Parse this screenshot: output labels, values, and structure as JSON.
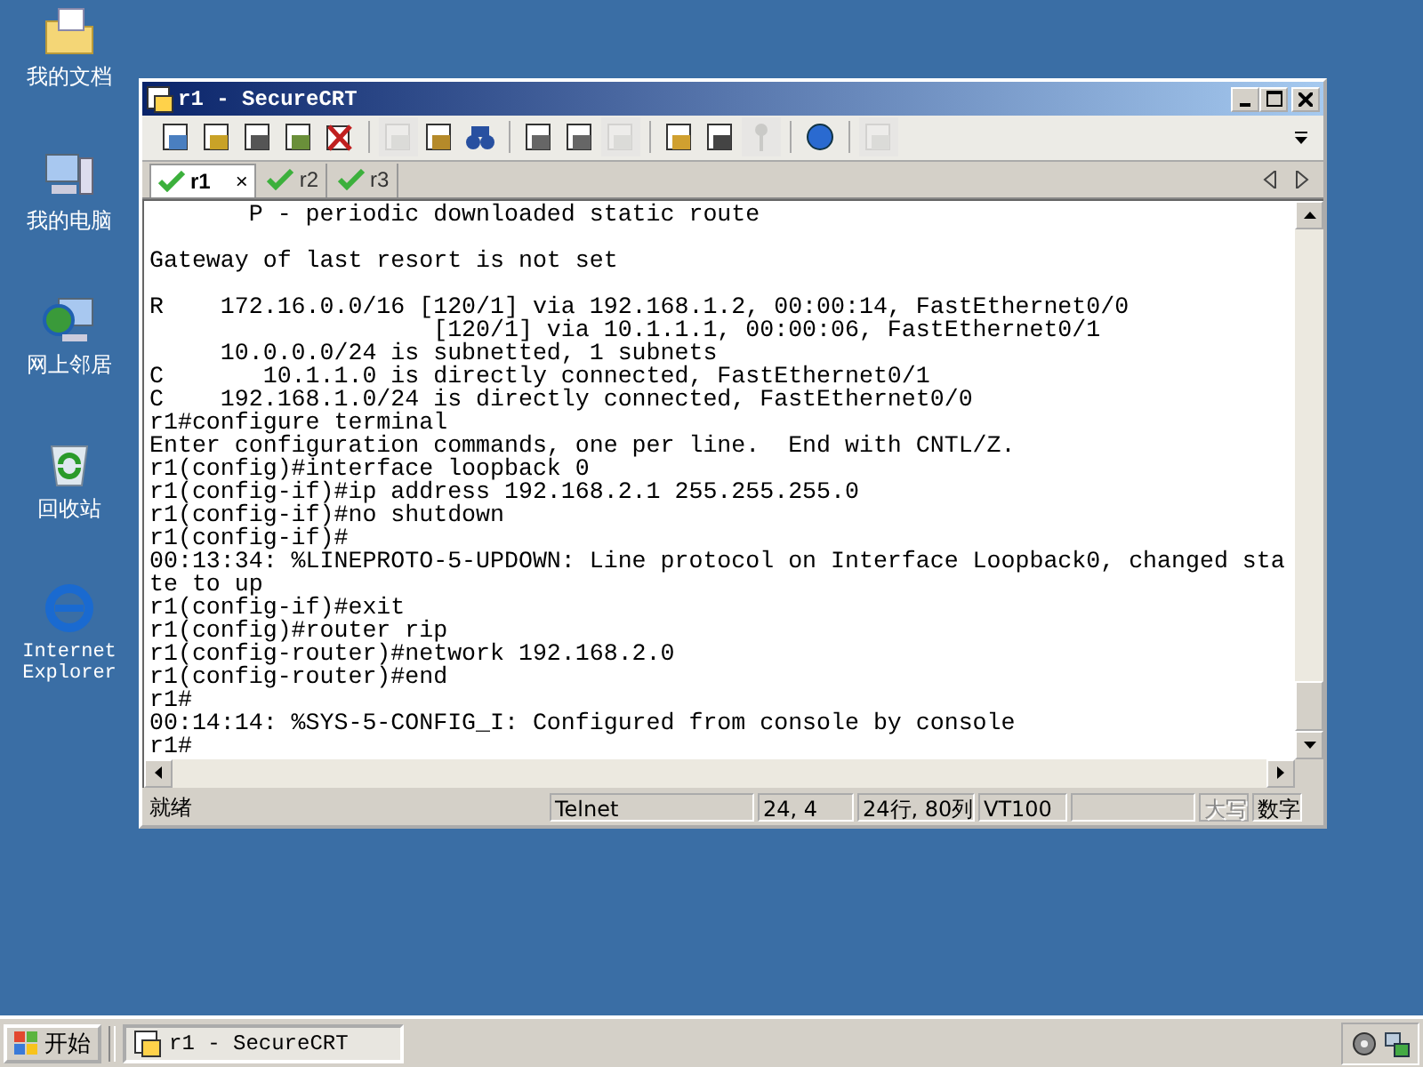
{
  "desktop_icons": [
    {
      "kind": "folder",
      "label": "我的文档"
    },
    {
      "kind": "computer",
      "label": "我的电脑"
    },
    {
      "kind": "network",
      "label": "网上邻居"
    },
    {
      "kind": "recycle",
      "label": "回收站"
    },
    {
      "kind": "browser",
      "label": "Internet Explorer"
    }
  ],
  "window": {
    "title": "r1 - SecureCRT",
    "toolbar": [
      {
        "buttons": [
          {
            "kind": "connect",
            "disabled": false
          },
          {
            "kind": "quick",
            "disabled": false
          },
          {
            "kind": "tab",
            "disabled": false
          },
          {
            "kind": "reconnect",
            "disabled": false
          },
          {
            "kind": "disconnect",
            "disabled": false
          }
        ]
      },
      {
        "buttons": [
          {
            "kind": "copy",
            "disabled": true
          },
          {
            "kind": "paste",
            "disabled": false
          },
          {
            "kind": "find",
            "disabled": false
          }
        ]
      },
      {
        "buttons": [
          {
            "kind": "print",
            "disabled": false
          },
          {
            "kind": "print",
            "disabled": false
          },
          {
            "kind": "print",
            "disabled": true
          }
        ]
      },
      {
        "buttons": [
          {
            "kind": "options",
            "disabled": false
          },
          {
            "kind": "map",
            "disabled": false
          },
          {
            "kind": "key",
            "disabled": true
          }
        ]
      },
      {
        "buttons": [
          {
            "kind": "help",
            "disabled": false
          }
        ]
      },
      {
        "buttons": [
          {
            "kind": "window",
            "disabled": true
          }
        ]
      }
    ],
    "tabs": [
      {
        "label": "r1",
        "selected": true,
        "close": "×"
      },
      {
        "label": "r2",
        "selected": false
      },
      {
        "label": "r3",
        "selected": false
      }
    ],
    "terminal_lines": [
      "       P - periodic downloaded static route",
      {
        "blank_before": true,
        "text": "Gateway of last resort is not set"
      },
      {
        "blank_before": true,
        "text": "R    172.16.0.0/16 [120/1] via 192.168.1.2, 00:00:14, FastEthernet0/0"
      },
      "                    [120/1] via 10.1.1.1, 00:00:06, FastEthernet0/1",
      "     10.0.0.0/24 is subnetted, 1 subnets",
      "C       10.1.1.0 is directly connected, FastEthernet0/1",
      "C    192.168.1.0/24 is directly connected, FastEthernet0/0",
      "r1#configure terminal",
      "Enter configuration commands, one per line.  End with CNTL/Z.",
      "r1(config)#interface loopback 0",
      "r1(config-if)#ip address 192.168.2.1 255.255.255.0",
      "r1(config-if)#no shutdown",
      "r1(config-if)#",
      "00:13:34: %LINEPROTO-5-UPDOWN: Line protocol on Interface Loopback0, changed sta",
      "te to up",
      "r1(config-if)#exit",
      "r1(config)#router rip",
      "r1(config-router)#network 192.168.2.0",
      "r1(config-router)#end",
      "r1#",
      "00:14:14: %SYS-5-CONFIG_I: Configured from console by console",
      "r1#"
    ],
    "status_bar": [
      {
        "kind": "text",
        "text": "就绪",
        "disabled": false
      },
      {
        "kind": "text",
        "text": "Telnet",
        "disabled": false
      },
      {
        "kind": "text",
        "text": "24,  4",
        "disabled": false
      },
      {
        "kind": "text",
        "text": "24行, 80列",
        "disabled": false
      },
      {
        "kind": "text",
        "text": "VT100",
        "disabled": false
      },
      {
        "kind": "empty",
        "disabled": false
      },
      {
        "kind": "text",
        "text": "大写",
        "disabled": true
      },
      {
        "kind": "text",
        "text": "数字",
        "disabled": false
      }
    ]
  },
  "taskbar": {
    "start": "开始",
    "tasks": [
      {
        "label": "r1 - SecureCRT",
        "selected": true
      }
    ]
  }
}
